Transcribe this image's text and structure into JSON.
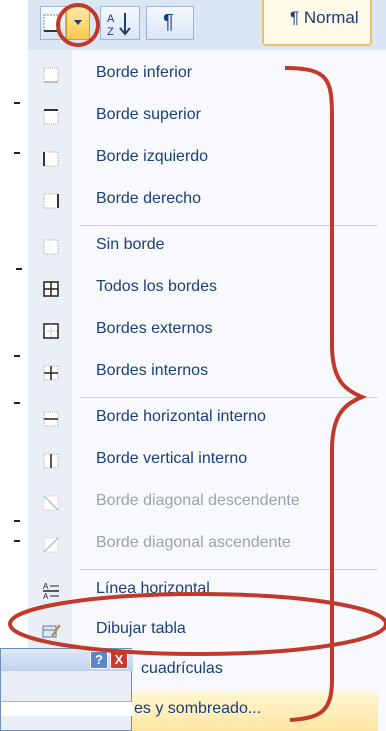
{
  "ribbon": {
    "style_label": "¶ Normal",
    "sort_icon": "sort-az-icon",
    "pilcrow_label": "¶"
  },
  "menu": {
    "items": [
      {
        "label": "Borde inferior",
        "icon": "border-bottom-icon",
        "enabled": true
      },
      {
        "label": "Borde superior",
        "icon": "border-top-icon",
        "enabled": true
      },
      {
        "label": "Borde izquierdo",
        "icon": "border-left-icon",
        "enabled": true
      },
      {
        "label": "Borde derecho",
        "icon": "border-right-icon",
        "enabled": true
      },
      {
        "label": "Sin borde",
        "icon": "no-border-icon",
        "enabled": true
      },
      {
        "label": "Todos los bordes",
        "icon": "all-borders-icon",
        "enabled": true
      },
      {
        "label": "Bordes externos",
        "icon": "outside-borders-icon",
        "enabled": true
      },
      {
        "label": "Bordes internos",
        "icon": "inside-borders-icon",
        "enabled": true
      },
      {
        "label": "Borde horizontal interno",
        "icon": "inside-horizontal-border-icon",
        "enabled": true
      },
      {
        "label": "Borde vertical interno",
        "icon": "inside-vertical-border-icon",
        "enabled": true
      },
      {
        "label": "Borde diagonal descendente",
        "icon": "diagonal-down-border-icon",
        "enabled": false
      },
      {
        "label": "Borde diagonal ascendente",
        "icon": "diagonal-up-border-icon",
        "enabled": false
      },
      {
        "label": "Línea horizontal",
        "icon": "horizontal-line-icon",
        "enabled": true
      },
      {
        "label": "Dibujar tabla",
        "icon": "draw-table-icon",
        "enabled": true
      },
      {
        "label": "cuadrículas",
        "icon": "gridlines-icon",
        "enabled": true
      },
      {
        "label": "es y sombreado...",
        "icon": "borders-shading-icon",
        "enabled": true
      }
    ]
  },
  "dialog": {
    "help_label": "?",
    "close_label": "X"
  },
  "colors": {
    "annotation": "#c0392b",
    "menu_text": "#1a3f7a",
    "disabled_text": "#9aa3ad"
  }
}
